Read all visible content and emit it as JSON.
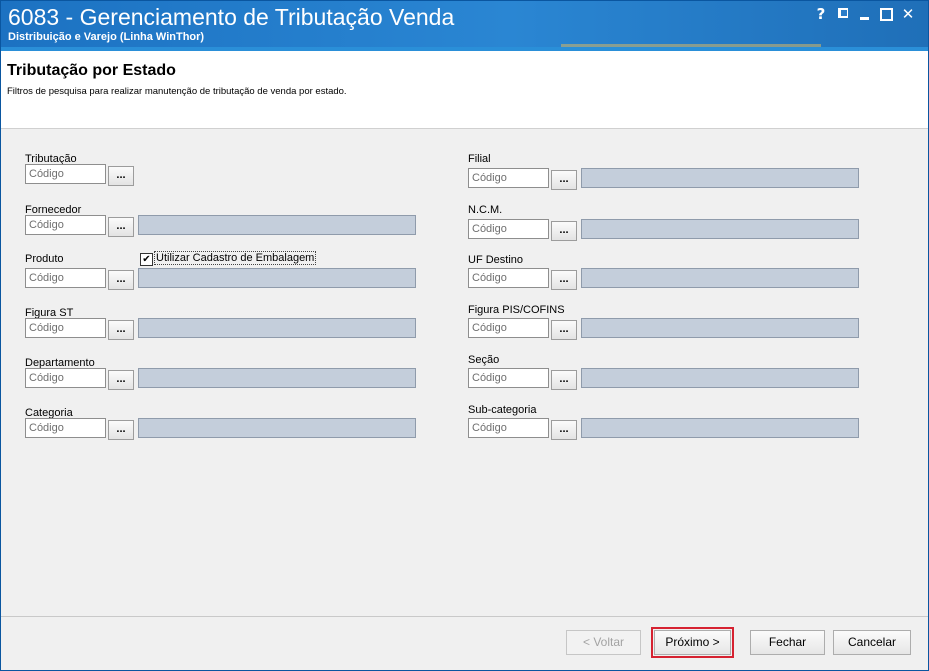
{
  "window": {
    "title": "6083 - Gerenciamento de Tributação Venda",
    "subtitle": "Distribuição e Varejo (Linha WinThor)",
    "controls": {
      "help": "?",
      "close": "✕"
    }
  },
  "header": {
    "title": "Tributação por Estado",
    "description": "Filtros de pesquisa para realizar manutenção de tributação de venda por estado."
  },
  "filters": {
    "code_placeholder": "Código",
    "lookup_label": "...",
    "tributacao": {
      "label": "Tributação",
      "value": "Código"
    },
    "fornecedor": {
      "label": "Fornecedor",
      "value": "Código"
    },
    "produto": {
      "label": "Produto",
      "value": "Código"
    },
    "utilizar_cadastro": {
      "label": "Utilizar Cadastro de Embalagem",
      "checked": true,
      "mark": "✔"
    },
    "figura_st": {
      "label": "Figura ST",
      "value": "Código"
    },
    "departamento": {
      "label": "Departamento",
      "value": "Código"
    },
    "categoria": {
      "label": "Categoria",
      "value": "Código"
    },
    "filial": {
      "label": "Filial",
      "value": "Código"
    },
    "ncm": {
      "label": "N.C.M.",
      "value": "Código"
    },
    "uf_destino": {
      "label": "UF Destino",
      "value": "Código"
    },
    "figura_pis_cofins": {
      "label": "Figura PIS/COFINS",
      "value": "Código"
    },
    "secao": {
      "label": "Seção",
      "value": "Código"
    },
    "sub_categoria": {
      "label": "Sub-categoria",
      "value": "Código"
    }
  },
  "footer": {
    "voltar": "< Voltar",
    "proximo": "Próximo >",
    "fechar": "Fechar",
    "cancelar": "Cancelar"
  },
  "colors": {
    "titlebar": "#2a86d3",
    "description_field": "#c4cedb",
    "highlight": "#d62231"
  }
}
